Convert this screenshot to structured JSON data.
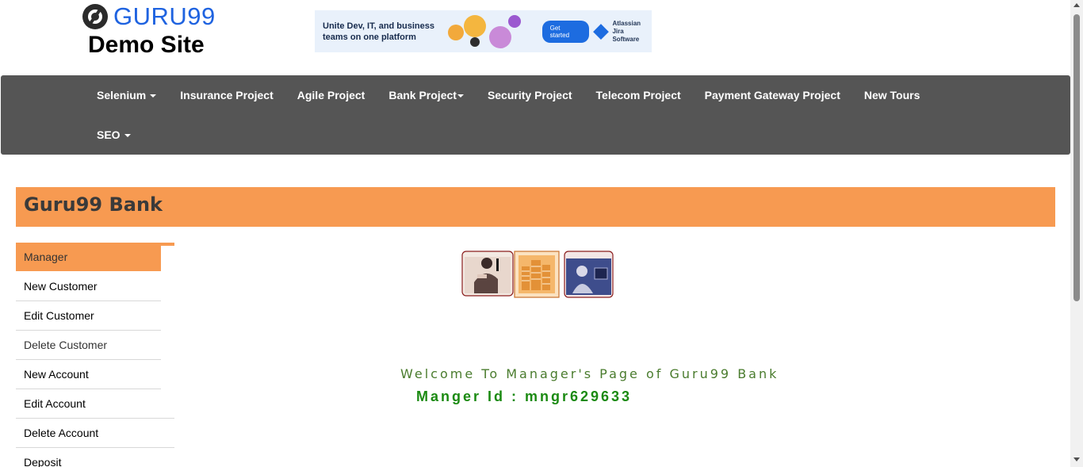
{
  "header": {
    "logo_text": "GURU99",
    "logo_subtitle": "Demo Site"
  },
  "ad": {
    "headline": "Unite Dev, IT, and business teams on one platform",
    "cta": "Get started",
    "brand_line1": "Atlassian",
    "brand_line2": "Jira Software"
  },
  "nav": {
    "row1": [
      "Selenium",
      "Insurance Project",
      "Agile Project",
      "Bank Project",
      "Security Project",
      "Telecom Project",
      "Payment Gateway Project",
      "New Tours"
    ],
    "row2": [
      "SEO"
    ]
  },
  "bank": {
    "title": "Guru99 Bank"
  },
  "menu": {
    "items": [
      "Manager",
      "New Customer",
      "Edit Customer",
      "Delete Customer",
      "New Account",
      "Edit Account",
      "Delete Account",
      "Deposit"
    ]
  },
  "content": {
    "welcome": "Welcome To Manager's Page of Guru99 Bank",
    "manager_id": "Manger Id : mngr629633"
  },
  "colors": {
    "nav_bg": "#555555",
    "accent_orange": "#f79a51",
    "logo_blue": "#1f63e0",
    "welcome_green": "#4a7c2e",
    "id_green": "#1b8a12"
  }
}
